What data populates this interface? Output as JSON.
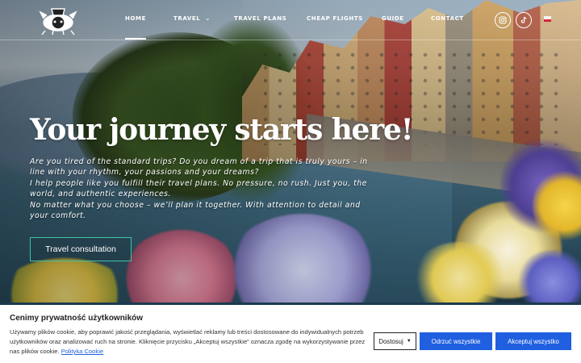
{
  "nav": {
    "home": "HOME",
    "travel": "TRAVEL",
    "travel_plans": "TRAVEL PLANS",
    "cheap_flights": "CHEAP FLIGHTS",
    "guide": "GUIDE",
    "contact": "CONTACT",
    "active": "HOME"
  },
  "social": {
    "instagram_icon": "instagram-icon",
    "tiktok_icon": "tiktok-icon",
    "flag": "poland-flag-icon"
  },
  "hero": {
    "headline": "Your journey starts here!",
    "paragraphs": [
      "Are you tired of the standard trips? Do you dream of a trip that is truly yours – in line with your rhythm, your passions and your dreams?",
      "I help people like you fulfill their travel plans. No pressure, no rush. Just you, the world, and authentic experiences.",
      "No matter what you choose – we’ll plan it together. With attention to detail and your comfort."
    ],
    "cta": "Travel consultation"
  },
  "cookie": {
    "title": "Cenimy prywatność użytkowników",
    "text": "Używamy plików cookie, aby poprawić jakość przeglądania, wyświetlać reklamy lub treści dostosowane do indywidualnych potrzeb użytkowników oraz analizować ruch na stronie. Kliknięcie przycisku „Akceptuj wszystkie” oznacza zgodę na wykorzystywanie przez nas plików cookie.",
    "link": "Polityka Cookie",
    "customize": "Dostosuj",
    "reject": "Odrzuć wszystkie",
    "accept": "Akceptuj wszystko"
  },
  "colors": {
    "accent_button": "#1f5fe0",
    "cta_border": "#3fc4a4"
  }
}
